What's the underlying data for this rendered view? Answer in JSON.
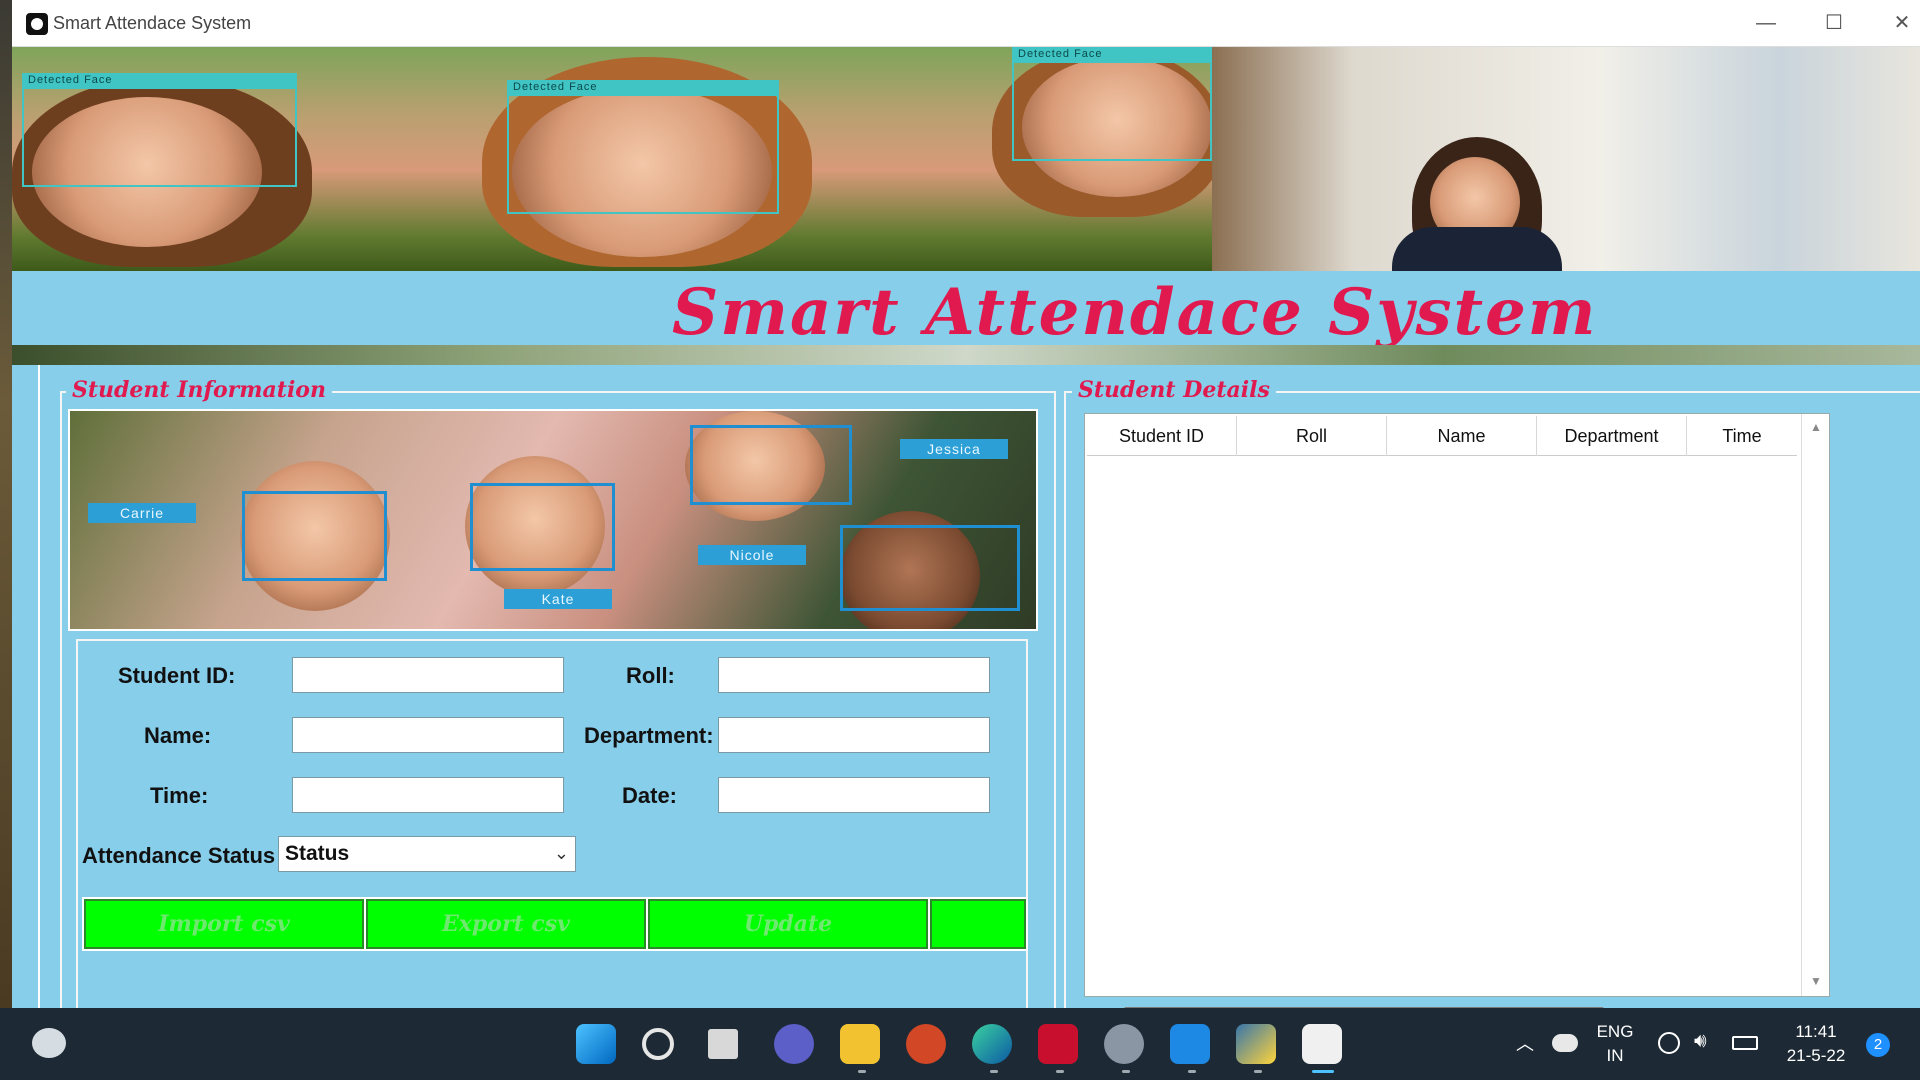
{
  "window": {
    "title": "Smart Attendace System",
    "controls": {
      "minimize": "—",
      "maximize": "☐",
      "close": "✕"
    }
  },
  "header": {
    "detected_face_label": "Detected Face",
    "main_title": "Smart Attendace System"
  },
  "student_info": {
    "legend": "Student Information",
    "collage_names": [
      "Carrie",
      "Kate",
      "Nicole",
      "Jessica"
    ],
    "fields": {
      "student_id": {
        "label": "Student ID:",
        "value": ""
      },
      "roll": {
        "label": "Roll:",
        "value": ""
      },
      "name": {
        "label": "Name:",
        "value": ""
      },
      "department": {
        "label": "Department:",
        "value": ""
      },
      "time": {
        "label": "Time:",
        "value": ""
      },
      "date": {
        "label": "Date:",
        "value": ""
      }
    },
    "attendance": {
      "label": "Attendance Status",
      "value": "Status"
    },
    "buttons": {
      "import": "Import csv",
      "export": "Export csv",
      "update": "Update",
      "extra": ""
    }
  },
  "student_details": {
    "legend": "Student Details",
    "columns": [
      "Student ID",
      "Roll",
      "Name",
      "Department",
      "Time"
    ]
  },
  "taskbar": {
    "language": "ENG",
    "region": "IN",
    "time": "11:41",
    "date": "21-5-22",
    "notifications": "2"
  },
  "colors": {
    "panel": "#87ceeb",
    "title_red": "#e0194e",
    "button_green": "#00ff00"
  }
}
